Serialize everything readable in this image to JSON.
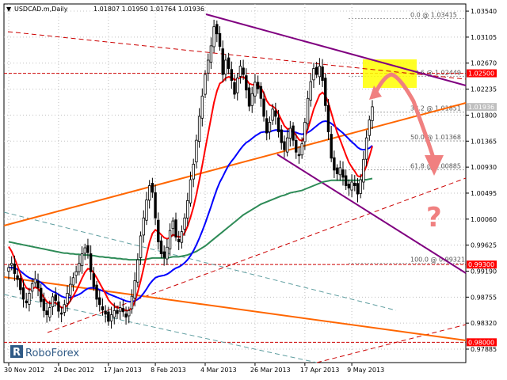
{
  "header": {
    "symbol": "USDCAD.m,Daily",
    "ohlc": "1.0180‍7 1.01950 1.01764 1.01936"
  },
  "logo": {
    "text": "RoboForex"
  },
  "colors": {
    "background": "#ffffff",
    "candle": "#000000",
    "ma_red": "#ff0000",
    "ma_blue": "#0000ff",
    "ma_green": "#2e8b57",
    "trend_orange": "#ff6600",
    "channel_purple": "#800080",
    "grid": "#c0c0c0",
    "hline_red": "#cc0000",
    "hline_label_bg": "#ff0000",
    "highlight": "#ffff00",
    "arrow": "#f08080",
    "current_price_bg": "#c0c0c0",
    "fib": "#a0a0a0"
  },
  "chart_data": {
    "type": "candlestick",
    "title": "USDCAD.m,Daily",
    "x_dates": [
      "30 Nov 2012",
      "24 Dec 2012",
      "17 Jan 2013",
      "8 Feb 2013",
      "4 Mar 2013",
      "26 Mar 2013",
      "17 Apr 2013",
      "9 May 2013"
    ],
    "y_ticks": [
      "1.03540",
      "1.03105",
      "1.02670",
      "1.02235",
      "1.01800",
      "1.01365",
      "1.00930",
      "1.00495",
      "1.00060",
      "0.99625",
      "0.99190",
      "0.98755",
      "0.98320",
      "0.97885"
    ],
    "ylim": [
      0.9766,
      1.0366
    ],
    "close_prices": [
      0.9925,
      0.9932,
      0.9915,
      0.9905,
      0.9888,
      0.9872,
      0.9866,
      0.9882,
      0.9898,
      0.9906,
      0.9891,
      0.9868,
      0.9853,
      0.9846,
      0.9858,
      0.9876,
      0.987,
      0.9852,
      0.9847,
      0.9863,
      0.9882,
      0.9897,
      0.9908,
      0.9918,
      0.9932,
      0.9948,
      0.9958,
      0.995,
      0.9918,
      0.9893,
      0.9872,
      0.9863,
      0.9854,
      0.9847,
      0.9835,
      0.9846,
      0.9853,
      0.9848,
      0.9858,
      0.9851,
      0.9842,
      0.9853,
      0.9877,
      0.9903,
      0.9938,
      0.9978,
      1.0008,
      1.0038,
      1.0062,
      1.0051,
      1.0008,
      0.9968,
      0.9948,
      0.9942,
      0.9959,
      0.9987,
      1.0003,
      0.9976,
      0.9968,
      0.9985,
      1.0008,
      1.0037,
      1.0072,
      1.0098,
      1.0138,
      1.0178,
      1.0212,
      1.0248,
      1.0272,
      1.0296,
      1.0328,
      1.0316,
      1.0295,
      1.0248,
      1.0272,
      1.0258,
      1.0238,
      1.0215,
      1.0242,
      1.0262,
      1.0248,
      1.0222,
      1.0195,
      1.0216,
      1.0235,
      1.0224,
      1.0208,
      1.0178,
      1.015,
      1.0168,
      1.019,
      1.0178,
      1.0152,
      1.0134,
      1.0122,
      1.0142,
      1.0158,
      1.0138,
      1.0118,
      1.0112,
      1.0132,
      1.0168,
      1.0208,
      1.0236,
      1.0258,
      1.0248,
      1.0262,
      1.0238,
      1.0196,
      1.0152,
      1.0108,
      1.0088,
      1.0082,
      1.0092,
      1.0076,
      1.0062,
      1.0058,
      1.0068,
      1.0062,
      1.0048,
      1.0072,
      1.0106,
      1.0142,
      1.0172,
      1.0194
    ],
    "ma_red": [
      0.996,
      0.9952,
      0.994,
      0.9928,
      0.9914,
      0.99,
      0.9891,
      0.9888,
      0.9889,
      0.9892,
      0.989,
      0.9883,
      0.9875,
      0.9868,
      0.9865,
      0.9866,
      0.9866,
      0.9862,
      0.9858,
      0.9858,
      0.9862,
      0.9869,
      0.9877,
      0.9886,
      0.9896,
      0.9907,
      0.9917,
      0.9923,
      0.9922,
      0.9916,
      0.9908,
      0.9899,
      0.989,
      0.9881,
      0.9871,
      0.9865,
      0.9861,
      0.9858,
      0.9857,
      0.9855,
      0.9853,
      0.9853,
      0.9858,
      0.9868,
      0.9884,
      0.9903,
      0.9924,
      0.9946,
      0.9967,
      0.9982,
      0.9988,
      0.9985,
      0.998,
      0.9975,
      0.9973,
      0.9975,
      0.998,
      0.9978,
      0.9976,
      0.9977,
      0.9983,
      0.9994,
      1.0009,
      1.0026,
      1.0047,
      1.0071,
      1.0096,
      1.0123,
      1.0149,
      1.0175,
      1.0201,
      1.022,
      1.0233,
      1.0236,
      1.0242,
      1.0244,
      1.0243,
      1.0239,
      1.024,
      1.0243,
      1.0244,
      1.024,
      1.0233,
      1.0231,
      1.0231,
      1.023,
      1.0226,
      1.0217,
      1.0204,
      1.0197,
      1.0195,
      1.0191,
      1.0182,
      1.0172,
      1.0162,
      1.0157,
      1.0157,
      1.0153,
      1.0146,
      1.0139,
      1.0137,
      1.0143,
      1.0157,
      1.0173,
      1.019,
      1.0202,
      1.0214,
      1.0218,
      1.0213,
      1.0201,
      1.0184,
      1.0167,
      1.0151,
      1.0139,
      1.0126,
      1.0113,
      1.0101,
      1.0093,
      1.0086,
      1.0078,
      1.0077,
      1.0083,
      1.0095,
      1.0111,
      1.0128
    ],
    "ma_blue": [
      0.9925,
      0.9925,
      0.9924,
      0.9922,
      0.9919,
      0.9915,
      0.9911,
      0.9908,
      0.9906,
      0.9905,
      0.9903,
      0.99,
      0.9896,
      0.9891,
      0.9888,
      0.9885,
      0.9883,
      0.988,
      0.9877,
      0.9875,
      0.9875,
      0.9875,
      0.9876,
      0.9878,
      0.988,
      0.9883,
      0.9887,
      0.989,
      0.9891,
      0.9891,
      0.989,
      0.9888,
      0.9886,
      0.9884,
      0.9881,
      0.9879,
      0.9877,
      0.9875,
      0.9873,
      0.9871,
      0.9869,
      0.9868,
      0.9868,
      0.9869,
      0.9872,
      0.9876,
      0.9882,
      0.9889,
      0.9897,
      0.9903,
      0.9908,
      0.991,
      0.9911,
      0.9912,
      0.9914,
      0.9917,
      0.9921,
      0.9924,
      0.9926,
      0.9929,
      0.9933,
      0.9938,
      0.9945,
      0.9953,
      0.9963,
      0.9974,
      0.9986,
      0.9999,
      1.0013,
      1.0027,
      1.0042,
      1.0056,
      1.0068,
      1.0077,
      1.0087,
      1.0096,
      1.0103,
      1.0109,
      1.0116,
      1.0123,
      1.0129,
      1.0134,
      1.0137,
      1.0141,
      1.0145,
      1.0148,
      1.0151,
      1.0152,
      1.0152,
      1.0152,
      1.0154,
      1.0155,
      1.0155,
      1.0154,
      1.0153,
      1.0153,
      1.0153,
      1.0152,
      1.0151,
      1.0149,
      1.0148,
      1.0149,
      1.0151,
      1.0154,
      1.0158,
      1.0162,
      1.0166,
      1.0169,
      1.017,
      1.0169,
      1.0166,
      1.0162,
      1.0158,
      1.0154,
      1.015,
      1.0145,
      1.014,
      1.0135,
      1.0131,
      1.0126,
      1.0123,
      1.0122,
      1.0123,
      1.0125,
      1.0129
    ],
    "ma_green": [
      0.9968,
      0.9967,
      0.9966,
      0.9965,
      0.9964,
      0.9963,
      0.9962,
      0.9961,
      0.996,
      0.9959,
      0.9958,
      0.9957,
      0.9956,
      0.9955,
      0.9954,
      0.9953,
      0.9952,
      0.9951,
      0.995,
      0.9949,
      0.9949,
      0.9948,
      0.9948,
      0.9947,
      0.9947,
      0.9946,
      0.9946,
      0.9946,
      0.9945,
      0.9945,
      0.9944,
      0.9943,
      0.9943,
      0.9942,
      0.9942,
      0.9941,
      0.9941,
      0.994,
      0.994,
      0.9939,
      0.9939,
      0.9938,
      0.9938,
      0.9938,
      0.9938,
      0.9938,
      0.9938,
      0.9939,
      0.994,
      0.9941,
      0.9941,
      0.9941,
      0.9941,
      0.9941,
      0.9941,
      0.9942,
      0.9943,
      0.9943,
      0.9943,
      0.9944,
      0.9945,
      0.9946,
      0.9948,
      0.995,
      0.9952,
      0.9955,
      0.9958,
      0.9961,
      0.9965,
      0.9969,
      0.9973,
      0.9977,
      0.9981,
      0.9985,
      0.9989,
      0.9993,
      0.9997,
      1.0001,
      1.0005,
      1.0009,
      1.0013,
      1.0016,
      1.0019,
      1.0022,
      1.0025,
      1.0028,
      1.0031,
      1.0033,
      1.0035,
      1.0037,
      1.0039,
      1.0041,
      1.0043,
      1.0045,
      1.0046,
      1.0048,
      1.005,
      1.0051,
      1.0052,
      1.0053,
      1.0054,
      1.0056,
      1.0058,
      1.006,
      1.0062,
      1.0064,
      1.0066,
      1.0068,
      1.0069,
      1.007,
      1.0071,
      1.0071,
      1.0071,
      1.0071,
      1.0071,
      1.0071,
      1.0071,
      1.0071,
      1.0071,
      1.0071,
      1.0071,
      1.0072,
      1.0072,
      1.0073,
      1.0074
    ],
    "fibonacci": [
      {
        "label": "0.0 @ 1.03415",
        "value": 1.03415
      },
      {
        "label": "23.6 @ 1.02449",
        "value": 1.02449
      },
      {
        "label": "38.2 @ 1.01851",
        "value": 1.01851
      },
      {
        "label": "50.0 @ 1.01368",
        "value": 1.01368
      },
      {
        "label": "61.8 @ 1.00885",
        "value": 1.00885
      },
      {
        "label": "100.0 @ 0.99321",
        "value": 0.99321
      }
    ],
    "price_labels": [
      {
        "text": "1.02500",
        "value": 1.025,
        "style": "red"
      },
      {
        "text": "1.01936",
        "value": 1.01936,
        "style": "current"
      },
      {
        "text": "0.99300",
        "value": 0.993,
        "style": "red"
      },
      {
        "text": "0.98000",
        "value": 0.98,
        "style": "red"
      }
    ],
    "annotations": {
      "question_mark": "?"
    },
    "grid": true
  }
}
